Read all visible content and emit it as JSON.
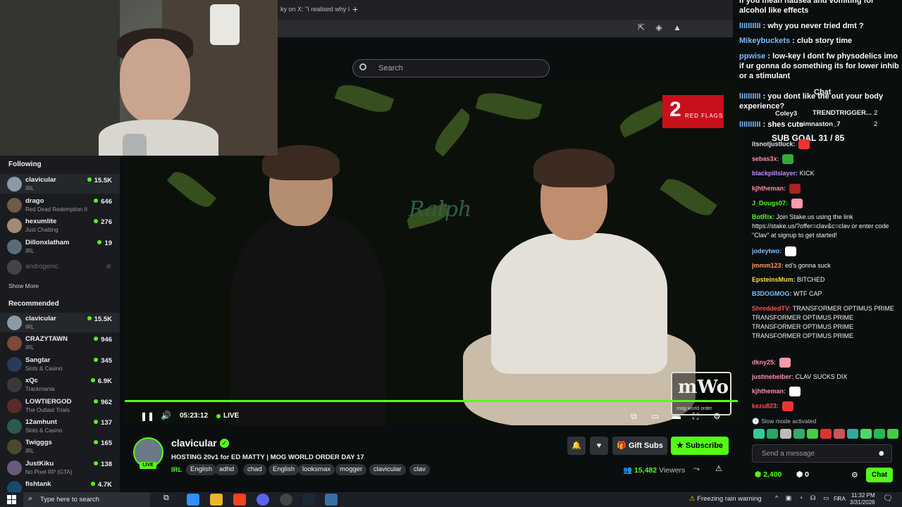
{
  "browser": {
    "tab_title": "ky on X: \"I realised why I",
    "new_tab": "+"
  },
  "topbar": {
    "search_placeholder": "Search"
  },
  "sidebar": {
    "following_heading": "Following",
    "following": [
      {
        "name": "clavicular",
        "category": "IRL",
        "viewers": "15.5K",
        "live": true,
        "color": "#8a9aa6"
      },
      {
        "name": "drago",
        "category": "Red Dead Redemption II",
        "viewers": "646",
        "live": true,
        "color": "#6e5a48"
      },
      {
        "name": "hexumlite",
        "category": "Just Chatting",
        "viewers": "276",
        "live": true,
        "color": "#a38a72"
      },
      {
        "name": "Dillonxlatham",
        "category": "IRL",
        "viewers": "19",
        "live": true,
        "color": "#5a6c7a"
      },
      {
        "name": "androgenic",
        "category": "",
        "viewers": "",
        "live": false,
        "color": "#444"
      }
    ],
    "show_more": "Show More",
    "recommended_heading": "Recommended",
    "recommended": [
      {
        "name": "clavicular",
        "category": "IRL",
        "viewers": "15.5K",
        "color": "#8a9aa6"
      },
      {
        "name": "CRAZYTAWN",
        "category": "IRL",
        "viewers": "946",
        "color": "#7a4a3a"
      },
      {
        "name": "Sangtar",
        "category": "Slots & Casino",
        "viewers": "345",
        "color": "#2a3a5a"
      },
      {
        "name": "xQc",
        "category": "Trackmania",
        "viewers": "6.9K",
        "color": "#3a3a3a"
      },
      {
        "name": "LOWTIERGOD",
        "category": "The Outlast Trials",
        "viewers": "962",
        "color": "#5a2a2a"
      },
      {
        "name": "12amhunt",
        "category": "Slots & Casino",
        "viewers": "137",
        "color": "#2a5a4a"
      },
      {
        "name": "Twigggs",
        "category": "IRL",
        "viewers": "165",
        "color": "#4a4a2a"
      },
      {
        "name": "JustKiku",
        "category": "No Pixel RP (GTA)",
        "viewers": "138",
        "color": "#6a5a7a"
      },
      {
        "name": "fishtank",
        "category": "",
        "viewers": "4.7K",
        "color": "#1a4a6a"
      }
    ]
  },
  "video": {
    "badge_number": "2",
    "badge_text": "RED FLAGS",
    "sweater_text": "Ralph",
    "logo_text": "mWo",
    "logo_sub": "mog world order"
  },
  "player": {
    "time": "05:23:12",
    "live_label": "LIVE",
    "progress": 1.0
  },
  "stream": {
    "streamer": "clavicular",
    "live_badge": "LIVE",
    "title": "HOSTING 20v1 for ED MATTY | MOG WORLD ORDER DAY 17",
    "category": "IRL",
    "tags": [
      "English",
      "adhd",
      "chad",
      "English",
      "looksmax",
      "mogger",
      "clavicular",
      "clav"
    ],
    "gift_label": "Gift Subs",
    "subscribe_label": "Subscribe",
    "viewers_count": "15,482",
    "viewers_label": "Viewers"
  },
  "chat": {
    "overlay_messages": [
      {
        "user": "",
        "text": "if you mean nausea and vomiting for alcohol like effects"
      },
      {
        "user": "lIIIIIIIII",
        "text": ": why you never tried dmt ?"
      },
      {
        "user": "Mikeybuckets",
        "text": ": club story time"
      },
      {
        "user": "ppwise",
        "text": ": low-key I dont fw physodelics imo if ur gonna do something its for lower inhib or a stimulant"
      },
      {
        "user": "lIIIIIIIII",
        "text": ": you dont like the out your body experience?"
      },
      {
        "user": "lIIIIIIIII",
        "text": ": shes cute"
      }
    ],
    "header_title": "Chat",
    "gifters": [
      {
        "name": "Coley3",
        "count": ""
      },
      {
        "name": "TRENDTRIGGER...",
        "count": "2"
      },
      {
        "name": "nimnaston_7",
        "count": "2"
      }
    ],
    "sub_goal": "SUB GOAL 31 / 85",
    "messages": [
      {
        "user": "itsnotjustluck:",
        "color": "#e5e5e5",
        "text": ""
      },
      {
        "user": "sebas3x:",
        "color": "#ff8fa6",
        "text": ""
      },
      {
        "user": "blackpillslayer:",
        "color": "#c18aff",
        "text": "KICK"
      },
      {
        "user": "kjhtheman:",
        "color": "#ff8fa6",
        "text": ""
      },
      {
        "user": "J_Dougs07:",
        "color": "#53fc18",
        "text": ""
      },
      {
        "user": "BotRix:",
        "color": "#53fc18",
        "text": "Join Stake.us using the link https://stake.us/?offer=clav&c=clav or enter code \"Clav\" at signup to get started!"
      },
      {
        "user": "jodeytwo:",
        "color": "#7cc0ff",
        "text": ""
      },
      {
        "user": "jmmm123:",
        "color": "#ff9a5a",
        "text": "ed's gonna suck"
      },
      {
        "user": "EpsteinsMum:",
        "color": "#ffd84a",
        "text": "BITCHED"
      },
      {
        "user": "B3DOGMOG:",
        "color": "#7cc0ff",
        "text": "WTF CAP"
      },
      {
        "user": "ShreddedTV:",
        "color": "#ff5050",
        "text": "TRANSFORMER OPTIMUS PRIME TRANSFORMER OPTIMUS PRIME TRANSFORMER OPTIMUS PRIME TRANSFORMER OPTIMUS PRIME"
      },
      {
        "user": "dkny25:",
        "color": "#ff8fa6",
        "text": ""
      },
      {
        "user": "justinebeiber:",
        "color": "#ff8fa6",
        "text": "CLAV SUCKS DIX"
      },
      {
        "user": "kjhtheman:",
        "color": "#ff8fa6",
        "text": ""
      },
      {
        "user": "kezu823:",
        "color": "#ff5050",
        "text": ""
      }
    ],
    "slow_mode": "Slow mode activated",
    "input_placeholder": "Send a message",
    "points": "2,400",
    "points_zero": "0",
    "send_label": "Chat"
  },
  "taskbar": {
    "search_placeholder": "Type here to search",
    "weather": "Freezing rain warning",
    "lang": "FRA",
    "time": "11:32 PM",
    "date": "3/31/2026"
  },
  "colors": {
    "accent": "#53fc18",
    "background": "#0b0e0f",
    "sidebar": "#191b1f",
    "red_badge": "#c8101b"
  }
}
